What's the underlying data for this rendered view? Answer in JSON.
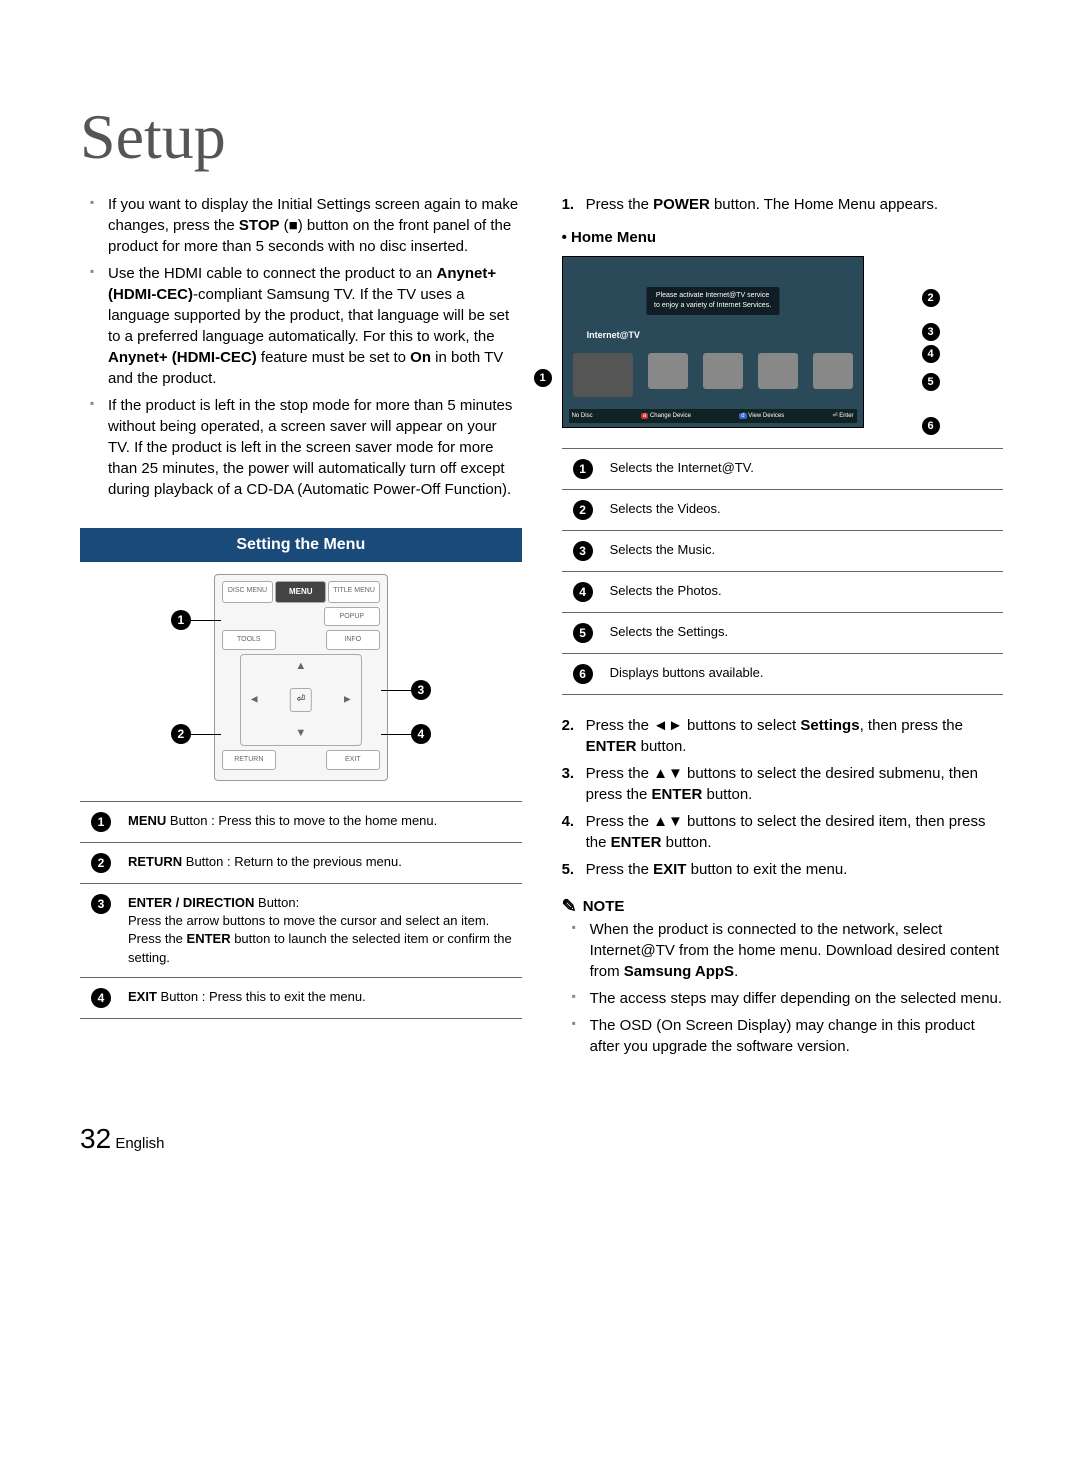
{
  "title": "Setup",
  "left_bullets": [
    {
      "prefix": "If you want to display the Initial Settings screen again to make changes, press the ",
      "b1": "STOP",
      "mid": " (",
      "sym": "■",
      "suffix": ") button on the front panel of the product for more than 5 seconds with no disc inserted."
    },
    {
      "prefix": "Use the HDMI cable to connect the product to an ",
      "b1": "Anynet+ (HDMI-CEC)",
      "mid": "-compliant Samsung TV. If the TV uses a language supported by the product, that language will be set to a preferred language automatically. For this to work, the ",
      "b2": "Anynet+ (HDMI-CEC)",
      "mid2": " feature must be set to ",
      "b3": "On",
      "suffix": " in both TV and the product."
    },
    {
      "prefix": "If the product is left in the stop mode for more than 5 minutes without being operated, a screen saver will appear on your TV. If the product is left in the screen saver mode for more than 25 minutes, the power will automatically turn off except during playback of a CD-DA (Automatic Power-Off Function).",
      "b1": "",
      "mid": "",
      "suffix": ""
    }
  ],
  "section_header": "Setting the Menu",
  "remote_labels": {
    "disc_menu": "DISC MENU",
    "menu": "MENU",
    "title_menu": "TITLE MENU",
    "popup": "POPUP",
    "tools": "TOOLS",
    "info": "INFO",
    "return": "RETURN",
    "exit": "EXIT"
  },
  "remote_callouts": [
    "1",
    "2",
    "3",
    "4"
  ],
  "remote_table": [
    {
      "num": "1",
      "b": "MENU",
      "rest": " Button : Press this to move to the home menu."
    },
    {
      "num": "2",
      "b": "RETURN",
      "rest": " Button : Return to the previous menu."
    },
    {
      "num": "3",
      "b": "ENTER / DIRECTION",
      "rest": " Button:\nPress the arrow buttons to move the cursor and select an item.\nPress the ",
      "b2": "ENTER",
      "rest2": " button to launch the selected item or confirm the setting."
    },
    {
      "num": "4",
      "b": "EXIT",
      "rest": " Button : Press this to exit the menu."
    }
  ],
  "right_steps_top": [
    {
      "n": "1.",
      "prefix": "Press the ",
      "b": "POWER",
      "suffix": " button. The Home Menu appears."
    }
  ],
  "home_menu_label": "• Home Menu",
  "tv": {
    "banner_line1": "Please activate Internet@TV service",
    "banner_line2": "to enjoy a variety of Internet Services.",
    "label": "Internet@TV",
    "bar_nodisc": "No Disc",
    "bar_change": "Change Device",
    "bar_change_key": "a",
    "bar_view": "View Devices",
    "bar_view_key": "d",
    "bar_enter": "Enter",
    "bar_enter_key": "⏎"
  },
  "hm_callouts": [
    "1",
    "2",
    "3",
    "4",
    "5",
    "6"
  ],
  "hm_table": [
    {
      "num": "1",
      "text": "Selects the Internet@TV."
    },
    {
      "num": "2",
      "text": "Selects the Videos."
    },
    {
      "num": "3",
      "text": "Selects the Music."
    },
    {
      "num": "4",
      "text": "Selects the Photos."
    },
    {
      "num": "5",
      "text": "Selects the Settings."
    },
    {
      "num": "6",
      "text": "Displays buttons available."
    }
  ],
  "right_steps_bottom": [
    {
      "n": "2.",
      "prefix": "Press the ◄► buttons to select ",
      "b": "Settings",
      "mid": ", then press the ",
      "b2": "ENTER",
      "suffix": " button."
    },
    {
      "n": "3.",
      "prefix": "Press the ▲▼ buttons to select the desired submenu, then press the ",
      "b": "ENTER",
      "suffix": " button."
    },
    {
      "n": "4.",
      "prefix": "Press the ▲▼ buttons to select the desired item, then press the ",
      "b": "ENTER",
      "suffix": " button."
    },
    {
      "n": "5.",
      "prefix": "Press the ",
      "b": "EXIT",
      "suffix": " button to exit the menu."
    }
  ],
  "note_label": "NOTE",
  "notes": [
    {
      "prefix": "When the product is connected to the network, select Internet@TV from the home menu. Download desired content from ",
      "b": "Samsung AppS",
      "suffix": "."
    },
    {
      "prefix": "The access steps may differ depending on the selected menu.",
      "b": "",
      "suffix": ""
    },
    {
      "prefix": "The OSD (On Screen Display) may change in this product after you upgrade the software version.",
      "b": "",
      "suffix": ""
    }
  ],
  "page_number": "32",
  "page_lang": "English"
}
